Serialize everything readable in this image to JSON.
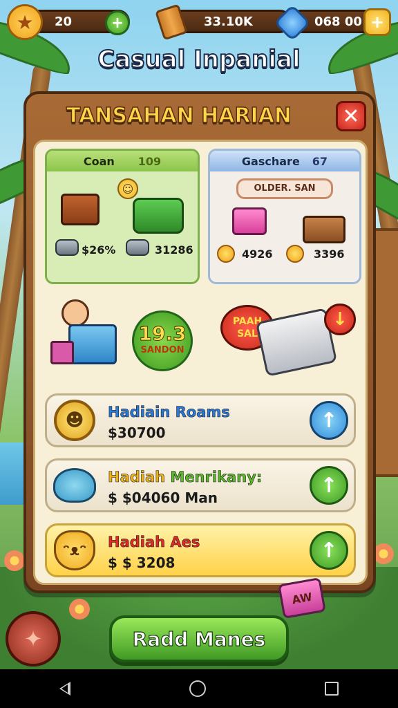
{
  "hud": {
    "currency_1": "20",
    "currency_2": "33.10K",
    "currency_3": "068 00"
  },
  "game_title": "Casual Inpanial",
  "panel": {
    "title": "TANSAHAN HARIAN",
    "close_icon": "close-x-icon"
  },
  "cards": {
    "left": {
      "label": "Coan",
      "count": "109",
      "prices": [
        "$26%",
        "31286"
      ]
    },
    "right": {
      "label": "Gaschare",
      "count": "67",
      "subtitle": "OLDER. SAN",
      "prices": [
        "4926",
        "3396"
      ]
    }
  },
  "middle": {
    "promo_value": "19.3",
    "promo_label": "SANDON",
    "sale_text": "PAAH SAL"
  },
  "rewards": [
    {
      "title": "Hadiain Roams",
      "amount": "$30700",
      "button_color": "#2f8ad8"
    },
    {
      "title": "Hadiah",
      "title_accent": "Menrikany:",
      "amount": "$ $04060 Man",
      "button_color": "#3d9a24"
    },
    {
      "title": "Hadiah Aes",
      "amount": "$ $ 3208",
      "button_color": "#3d9a24"
    }
  ],
  "corner_badge": "AW",
  "cta_label": "Radd Manes",
  "colors": {
    "panel_wood": "#7a4622",
    "panel_inner": "#f7efd6",
    "title_gold": "#ffd54a",
    "cta_green": "#3f9a24"
  }
}
